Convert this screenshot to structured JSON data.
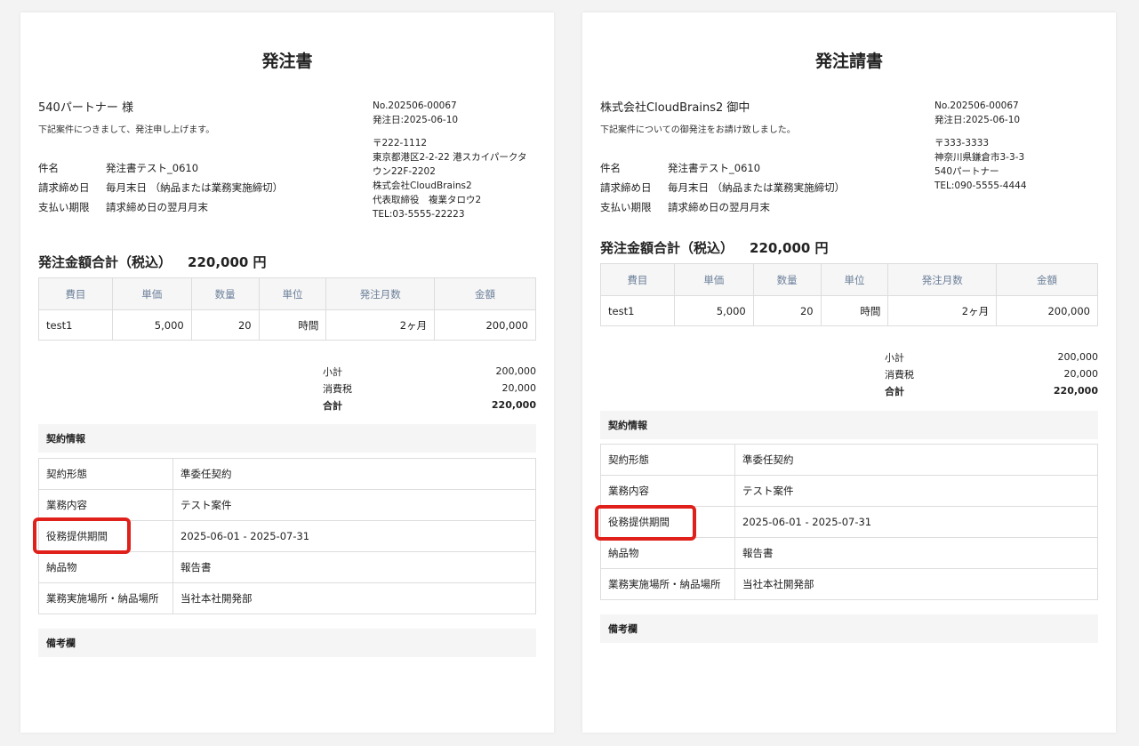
{
  "left": {
    "title": "発注書",
    "recipient": "540パートナー 様",
    "intro": "下記案件につきまして、発注申し上げます。",
    "meta": [
      {
        "label": "件名",
        "value": "発注書テスト_0610"
      },
      {
        "label": "請求締め日",
        "value": "毎月末日 （納品または業務実施締切）"
      },
      {
        "label": "支払い期限",
        "value": "請求締め日の翌月月末"
      }
    ],
    "sender": {
      "no": "No.202506-00067",
      "date": "発注日:2025-06-10",
      "postal": "〒222-1112",
      "addr1": "東京都港区2-2-22 港スカイパークタ",
      "addr2": "ウン22F-2202",
      "company": "株式会社CloudBrains2",
      "person": "代表取締役　複業タロウ2",
      "tel": "TEL:03-5555-22223"
    },
    "total_label": "発注金額合計（税込）",
    "total_amount": "220,000 円",
    "headers": [
      "費目",
      "単価",
      "数量",
      "単位",
      "発注月数",
      "金額"
    ],
    "row": [
      "test1",
      "5,000",
      "20",
      "時間",
      "2ヶ月",
      "200,000"
    ],
    "sums": [
      {
        "label": "小計",
        "value": "200,000"
      },
      {
        "label": "消費税",
        "value": "20,000"
      },
      {
        "label": "合計",
        "value": "220,000"
      }
    ],
    "contract_title": "契約情報",
    "contract": [
      {
        "label": "契約形態",
        "value": "準委任契約"
      },
      {
        "label": "業務内容",
        "value": "テスト案件"
      },
      {
        "label": "役務提供期間",
        "value": "2025-06-01 - 2025-07-31"
      },
      {
        "label": "納品物",
        "value": "報告書"
      },
      {
        "label": "業務実施場所・納品場所",
        "value": "当社本社開発部"
      }
    ],
    "remarks_title": "備考欄"
  },
  "right": {
    "title": "発注請書",
    "recipient": "株式会社CloudBrains2 御中",
    "intro": "下記案件についての御発注をお請け致しました。",
    "meta": [
      {
        "label": "件名",
        "value": "発注書テスト_0610"
      },
      {
        "label": "請求締め日",
        "value": "毎月末日 （納品または業務実施締切）"
      },
      {
        "label": "支払い期限",
        "value": "請求締め日の翌月月末"
      }
    ],
    "sender": {
      "no": "No.202506-00067",
      "date": "発注日:2025-06-10",
      "postal": "〒333-3333",
      "addr1": "神奈川県鎌倉市3-3-3",
      "company": "540パートナー",
      "tel": "TEL:090-5555-4444"
    },
    "total_label": "発注金額合計（税込）",
    "total_amount": "220,000 円",
    "headers": [
      "費目",
      "単価",
      "数量",
      "単位",
      "発注月数",
      "金額"
    ],
    "row": [
      "test1",
      "5,000",
      "20",
      "時間",
      "2ヶ月",
      "200,000"
    ],
    "sums": [
      {
        "label": "小計",
        "value": "200,000"
      },
      {
        "label": "消費税",
        "value": "20,000"
      },
      {
        "label": "合計",
        "value": "220,000"
      }
    ],
    "contract_title": "契約情報",
    "contract": [
      {
        "label": "契約形態",
        "value": "準委任契約"
      },
      {
        "label": "業務内容",
        "value": "テスト案件"
      },
      {
        "label": "役務提供期間",
        "value": "2025-06-01 - 2025-07-31"
      },
      {
        "label": "納品物",
        "value": "報告書"
      },
      {
        "label": "業務実施場所・納品場所",
        "value": "当社本社開発部"
      }
    ],
    "remarks_title": "備考欄"
  },
  "highlight_color": "#e0201a"
}
